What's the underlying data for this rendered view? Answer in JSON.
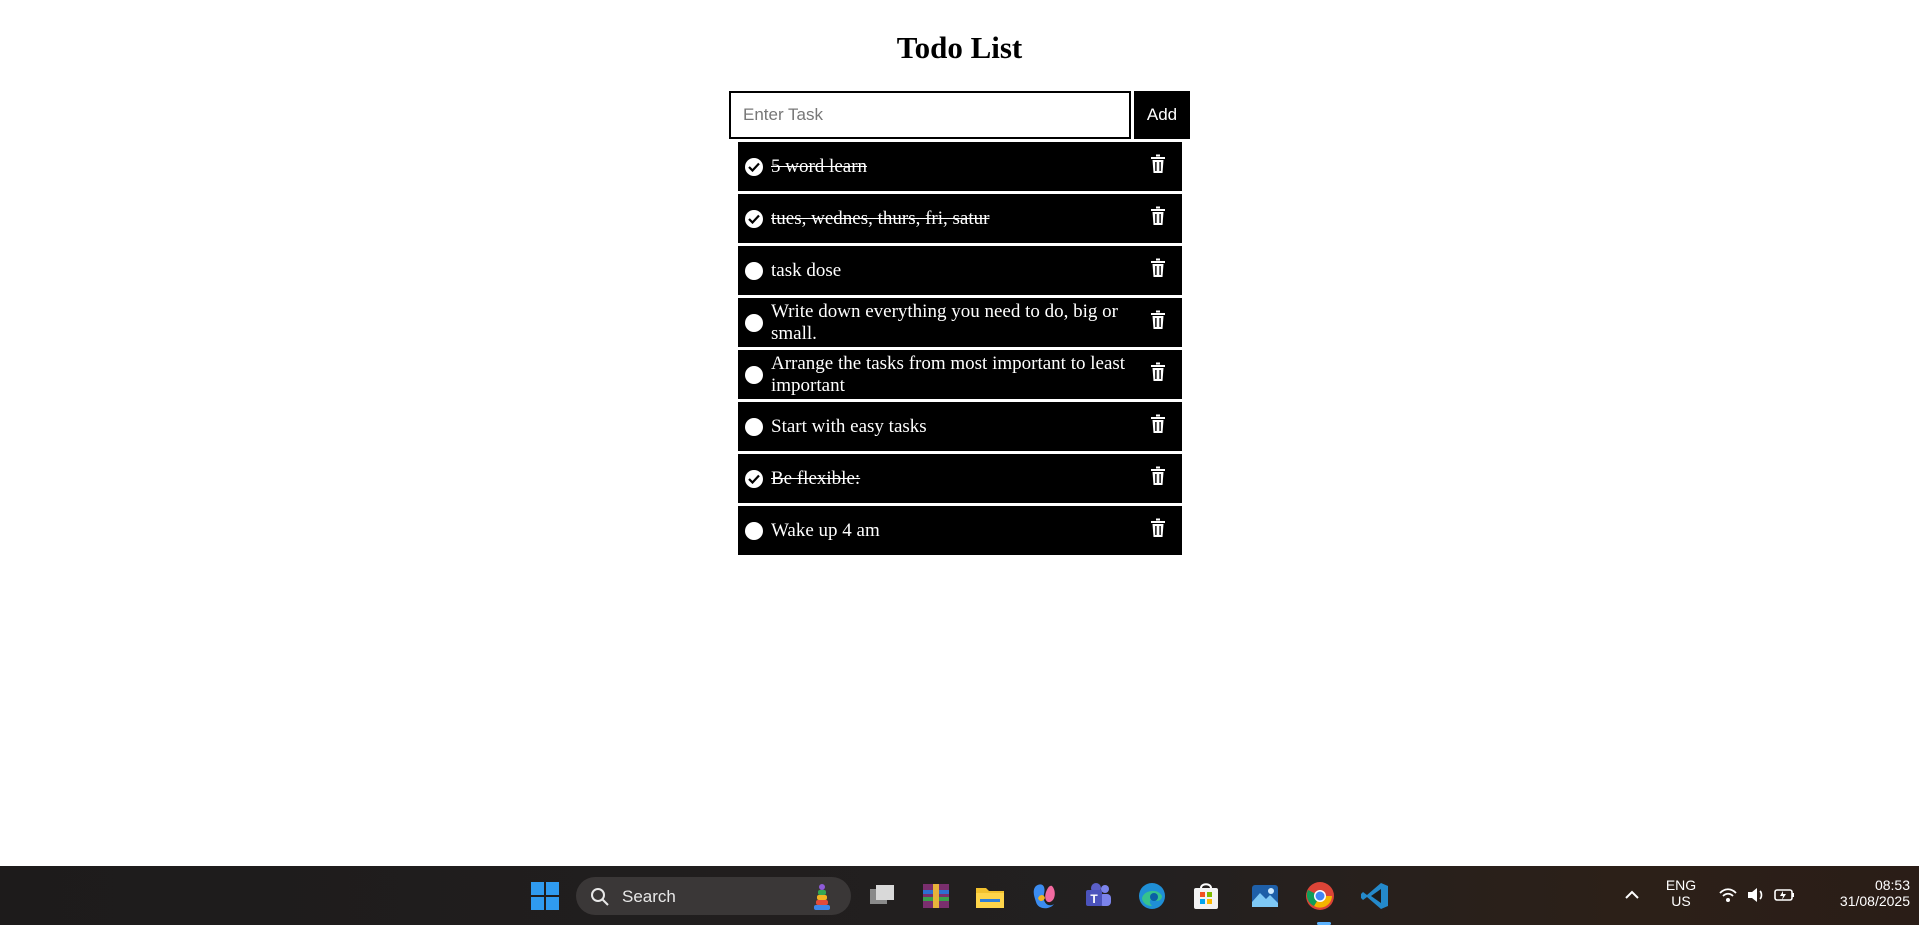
{
  "app": {
    "title": "Todo List",
    "input_placeholder": "Enter Task",
    "add_label": "Add"
  },
  "tasks": [
    {
      "text": "5 word learn",
      "done": true
    },
    {
      "text": "tues, wednes, thurs, fri, satur",
      "done": true
    },
    {
      "text": "task dose",
      "done": false
    },
    {
      "text": "Write down everything you need to do, big or small.",
      "done": false
    },
    {
      "text": "Arrange the tasks from most important to least important",
      "done": false
    },
    {
      "text": "Start with easy tasks",
      "done": false
    },
    {
      "text": "Be flexible:",
      "done": true
    },
    {
      "text": "Wake up 4 am",
      "done": false
    }
  ],
  "taskbar": {
    "search_label": "Search",
    "lang_line1": "ENG",
    "lang_line2": "US",
    "time": "08:53",
    "date": "31/08/2025",
    "icons": [
      "windows-start",
      "task-view",
      "winrar",
      "file-explorer",
      "copilot",
      "teams",
      "edge",
      "microsoft-store",
      "photos",
      "chrome",
      "vscode"
    ]
  }
}
